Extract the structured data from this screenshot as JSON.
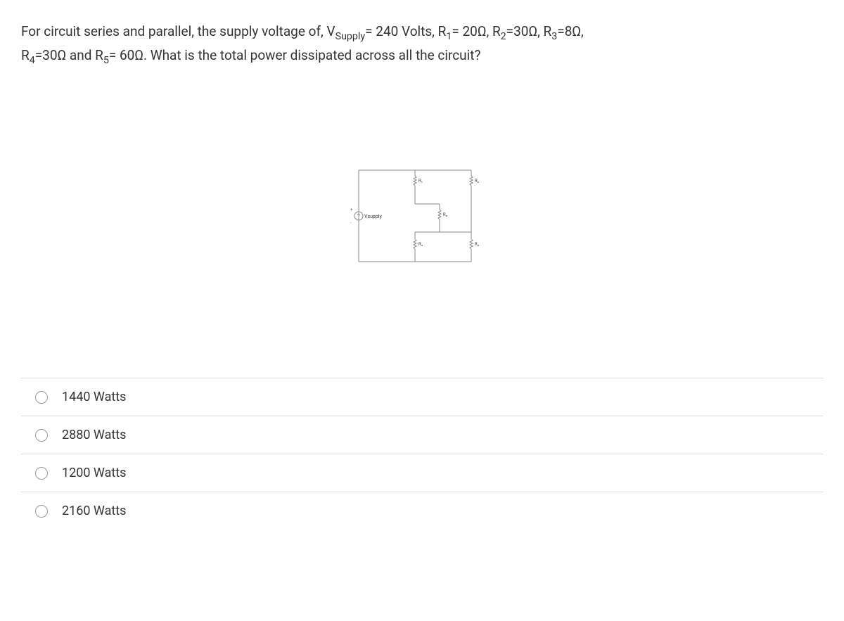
{
  "question": {
    "line1_parts": [
      "For circuit series and parallel, the supply voltage of, V",
      "Supply",
      "= 240 Volts, R",
      "1",
      "= 20Ω, R",
      "2",
      "=30Ω, R",
      "3",
      "=8Ω,"
    ],
    "line2_parts": [
      "R",
      "4",
      "=30Ω and R",
      "5",
      "= 60Ω. What is the total power dissipated across all the circuit?"
    ]
  },
  "circuit_labels": {
    "vsupply": "Vsupply",
    "r1": "R₁",
    "r2": "R₂",
    "r3": "R₃",
    "r4": "R₄",
    "r5": "R₅",
    "plus": "+",
    "minus": "-"
  },
  "options": [
    "1440 Watts",
    "2880 Watts",
    "1200 Watts",
    "2160 Watts"
  ]
}
